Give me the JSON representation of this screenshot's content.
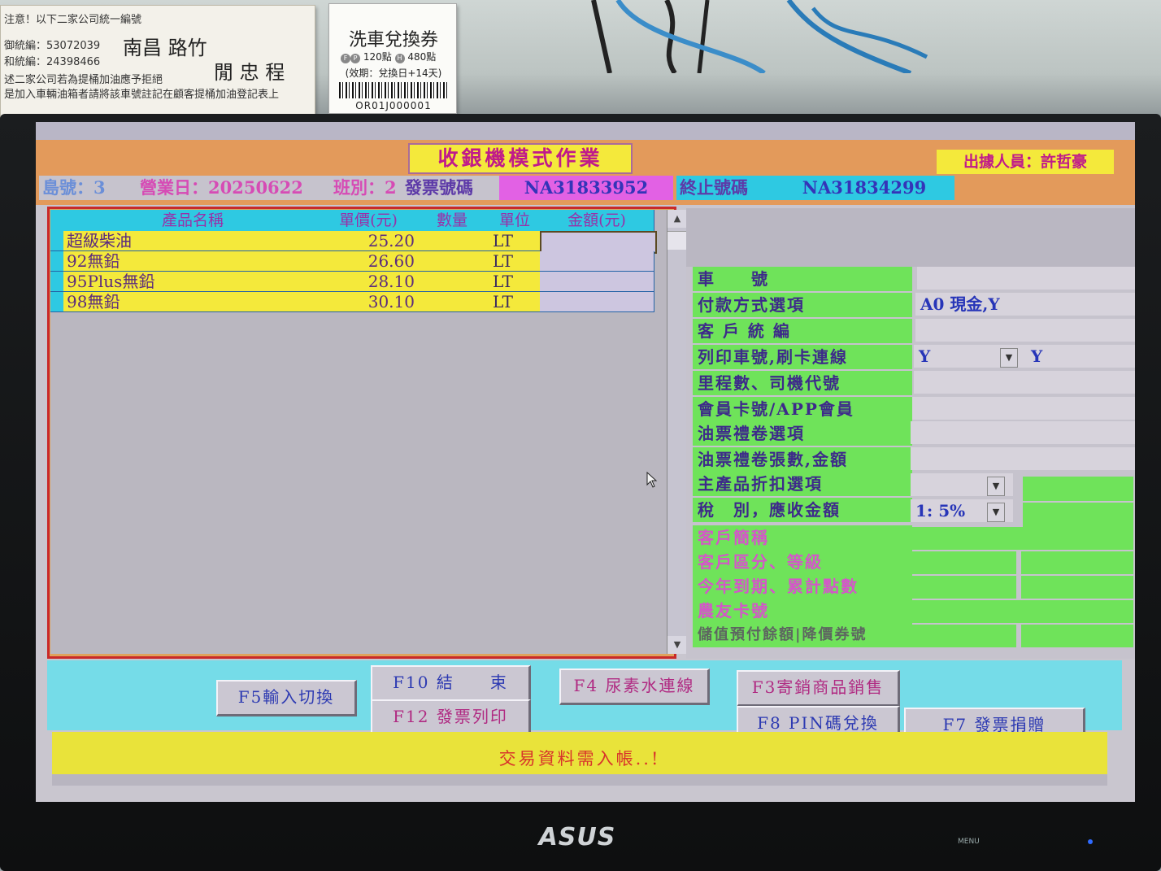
{
  "surroundings": {
    "notice_lines": [
      "注意！以下二家公司統一編號",
      "御統編：53072039",
      "和統編：24398466",
      "述二家公司若為提桶加油應予拒絕",
      "是加入車輛油箱者請將該車號註記在顧客提桶加油登記表上"
    ],
    "signature_line1": "南昌 路竹",
    "signature_line2": "閒 忠 程",
    "coupon_title": "洗車兌換券",
    "coupon_points_fp": "120點",
    "coupon_points_h": "480點",
    "coupon_validity": "(效期：兌換日+14天)",
    "coupon_code": "OR01J000001",
    "monitor_brand": "ASUS",
    "bezel_labels": [
      "MENU"
    ]
  },
  "app": {
    "title": "收銀機模式作業",
    "operator": "出據人員：許哲豪"
  },
  "info": {
    "island": "島號：3",
    "business_day": "營業日：20250622",
    "shift": "班別：2",
    "invoice_label": "發票號碼",
    "invoice_number": "NA31833952",
    "end_label": "終止號碼",
    "end_number": "NA31834299"
  },
  "grid": {
    "columns": [
      "產品名稱",
      "單價(元)",
      "數量",
      "單位",
      "金額(元)"
    ],
    "rows": [
      {
        "name": "超級柴油",
        "price": "25.20",
        "qty": "",
        "unit": "LT",
        "amount": ""
      },
      {
        "name": "92無鉛",
        "price": "26.60",
        "qty": "",
        "unit": "LT",
        "amount": ""
      },
      {
        "name": "95Plus無鉛",
        "price": "28.10",
        "qty": "",
        "unit": "LT",
        "amount": ""
      },
      {
        "name": "98無鉛",
        "price": "30.10",
        "qty": "",
        "unit": "LT",
        "amount": ""
      }
    ]
  },
  "form": {
    "plate_label": "車　　號",
    "payment_label": "付款方式選項",
    "payment_value": "A0 現金,Y",
    "tax_id_label": "客 戶 統 編",
    "print_plate_label": "列印車號,刷卡連線",
    "print_plate_value": "Y",
    "card_link_value": "Y",
    "mileage_label": "里程數、司機代號",
    "member_label": "會員卡號/APP會員",
    "voucher_option_label": "油票禮卷選項",
    "voucher_count_label": "油票禮卷張數,金額",
    "discount_label": "主產品折扣選項",
    "tax_label": "稅　別，應收金額",
    "tax_value": "1: 5%",
    "customer_name_label": "客戶簡稱",
    "customer_class_label": "客戶區分、等級",
    "expiry_label": "今年到期、累計點數",
    "farmer_card_label": "農友卡號",
    "prepaid_label": "儲值預付餘額|降價券號"
  },
  "buttons": {
    "f5": "F5輸入切換",
    "f10": "F10 結　　束",
    "f12": "F12 發票列印",
    "f4": "F4 尿素水連線",
    "f3": "F3寄銷商品銷售",
    "f8": "F8 PIN碼兌換",
    "f7": "F7 發票捐贈"
  },
  "status": "交易資料需入帳..!",
  "colors": {
    "title_bg": "#f4e93b",
    "frame_orange": "#e39a5b",
    "label_green": "#6fe35a",
    "header_cyan": "#2ec9e2",
    "button_area": "#75dce8"
  }
}
